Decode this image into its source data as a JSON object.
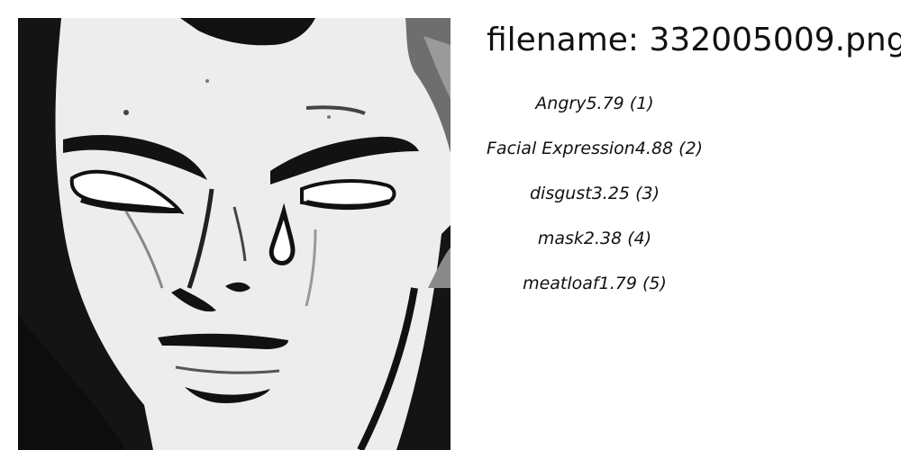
{
  "header": {
    "filename_text": "filename: 332005009.png"
  },
  "image": {
    "icon": "comic-face-image",
    "subject": "comic-style drawing of a face with closed eyes and a tear"
  },
  "results": [
    {
      "label": "Angry",
      "score": "5.79",
      "rank": "(1)"
    },
    {
      "label": "Facial Expression",
      "score": "4.88",
      "rank": "(2)"
    },
    {
      "label": "disgust",
      "score": "3.25",
      "rank": "(3)"
    },
    {
      "label": "mask",
      "score": "2.38",
      "rank": "(4)"
    },
    {
      "label": "meatloaf",
      "score": "1.79",
      "rank": "(5)"
    }
  ]
}
